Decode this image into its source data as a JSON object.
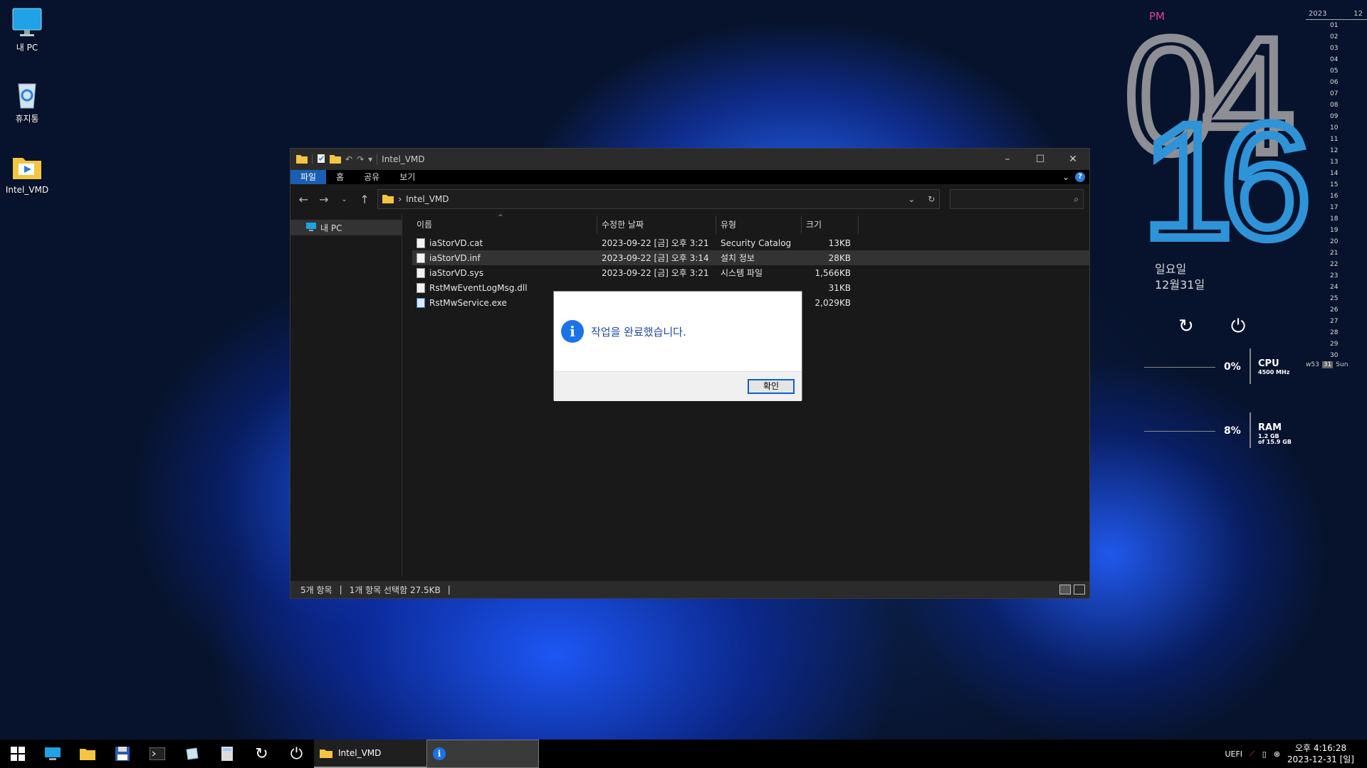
{
  "desktop": {
    "icons": [
      {
        "label": "내 PC"
      },
      {
        "label": "휴지통"
      },
      {
        "label": "Intel_VMD"
      }
    ]
  },
  "explorer": {
    "title": "Intel_VMD",
    "ribbon_tabs": [
      "파일",
      "홈",
      "공유",
      "보기"
    ],
    "address": {
      "separator": "›",
      "path": "Intel_VMD"
    },
    "nav_pane": {
      "item": "내 PC"
    },
    "columns": {
      "name": "이름",
      "date": "수정한 날짜",
      "type": "유형",
      "size": "크기"
    },
    "files": [
      {
        "name": "iaStorVD.cat",
        "date": "2023-09-22 [금] 오후 3:21",
        "type": "Security Catalog",
        "size": "13KB"
      },
      {
        "name": "iaStorVD.inf",
        "date": "2023-09-22 [금] 오후 3:14",
        "type": "설치 정보",
        "size": "28KB"
      },
      {
        "name": "iaStorVD.sys",
        "date": "2023-09-22 [금] 오후 3:21",
        "type": "시스템 파일",
        "size": "1,566KB"
      },
      {
        "name": "RstMwEventLogMsg.dll",
        "date": "",
        "type": "",
        "size": "31KB"
      },
      {
        "name": "RstMwService.exe",
        "date": "",
        "type": "",
        "size": "2,029KB"
      }
    ],
    "status": {
      "count": "5개 항목",
      "selection": "1개 항목 선택함 27.5KB"
    }
  },
  "dialog": {
    "message": "작업을 완료했습니다.",
    "ok_label": "확인"
  },
  "clock": {
    "ampm": "PM",
    "hour": "04",
    "minute": "16",
    "weekday": "일요일",
    "date": "12월31일"
  },
  "stats": {
    "cpu": {
      "percent": "0%",
      "label": "CPU",
      "sub": "4500 MHz"
    },
    "ram": {
      "percent": "8%",
      "label": "RAM",
      "sub1": "1.2 GB",
      "sub2": "of 15.9 GB"
    }
  },
  "calendar": {
    "year": "2023",
    "month": "12",
    "days": [
      "01",
      "02",
      "03",
      "04",
      "05",
      "06",
      "07",
      "08",
      "09",
      "10",
      "11",
      "12",
      "13",
      "14",
      "15",
      "16",
      "17",
      "18",
      "19",
      "20",
      "21",
      "22",
      "23",
      "24",
      "25",
      "26",
      "27",
      "28",
      "29",
      "30"
    ],
    "week": "w53",
    "today": "31",
    "today_name": "Sun"
  },
  "taskbar": {
    "tasks": [
      {
        "label": "Intel_VMD"
      },
      {
        "label": ""
      }
    ],
    "tray": {
      "uefi": "UEFI",
      "time": "오후 4:16:28",
      "date": "2023-12-31 [일]"
    }
  },
  "colors": {
    "accent": "#1a5fb4",
    "hour": "#8d8f94",
    "minute": "#2f93d8",
    "pm": "#e0409a"
  }
}
